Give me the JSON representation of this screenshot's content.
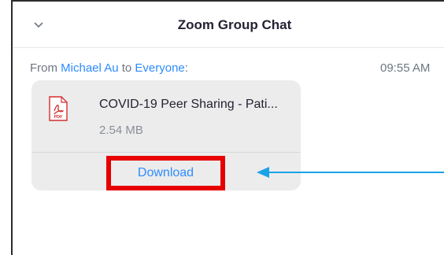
{
  "header": {
    "title": "Zoom Group Chat",
    "collapse_icon": "chevron-down-icon"
  },
  "message": {
    "from_prefix": "From ",
    "sender": "Michael Au",
    "to_word": " to ",
    "recipient": "Everyone",
    "suffix": ":",
    "time": "09:55 AM"
  },
  "file": {
    "icon": "pdf-icon",
    "name": "COVID-19 Peer Sharing - Pati...",
    "size": "2.54 MB",
    "download_label": "Download",
    "pdf_badge": "PDF"
  },
  "colors": {
    "accent": "#2d8cff",
    "highlight_box": "#e60000",
    "annotation_arrow": "#1aa3e8",
    "card_bg": "#ececec"
  }
}
